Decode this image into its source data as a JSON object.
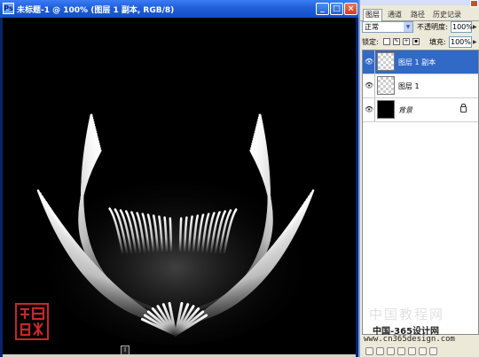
{
  "document": {
    "title": "未标题-1 @ 100% (图层 1 副本, RGB/8)",
    "icon": "photoshop-doc-icon",
    "controls": {
      "minimize": "_",
      "maximize": "□",
      "close": "×"
    },
    "canvas_marker": "I",
    "seal_text": "晓源",
    "seal_color": "#c4282a"
  },
  "layers_panel": {
    "tabs": [
      {
        "label": "图层",
        "active": true
      },
      {
        "label": "通道",
        "active": false
      },
      {
        "label": "路径",
        "active": false
      },
      {
        "label": "历史记录",
        "active": false
      }
    ],
    "blend_mode": "正常",
    "opacity_label": "不透明度:",
    "opacity_value": "100%",
    "lock_label": "锁定:",
    "fill_label": "填充:",
    "fill_value": "100%",
    "layers": [
      {
        "name": "图层 1 副本",
        "selected": true,
        "visible": true,
        "thumbnail": "transparent"
      },
      {
        "name": "图层 1",
        "selected": false,
        "visible": true,
        "thumbnail": "transparent"
      },
      {
        "name": "背景",
        "selected": false,
        "visible": true,
        "thumbnail": "black",
        "locked": true
      }
    ],
    "selection_color": "#3169c6"
  },
  "watermark": {
    "line1": "中国教程网",
    "line2": "中国-365设计网",
    "line3": "www.cn365design.com"
  }
}
